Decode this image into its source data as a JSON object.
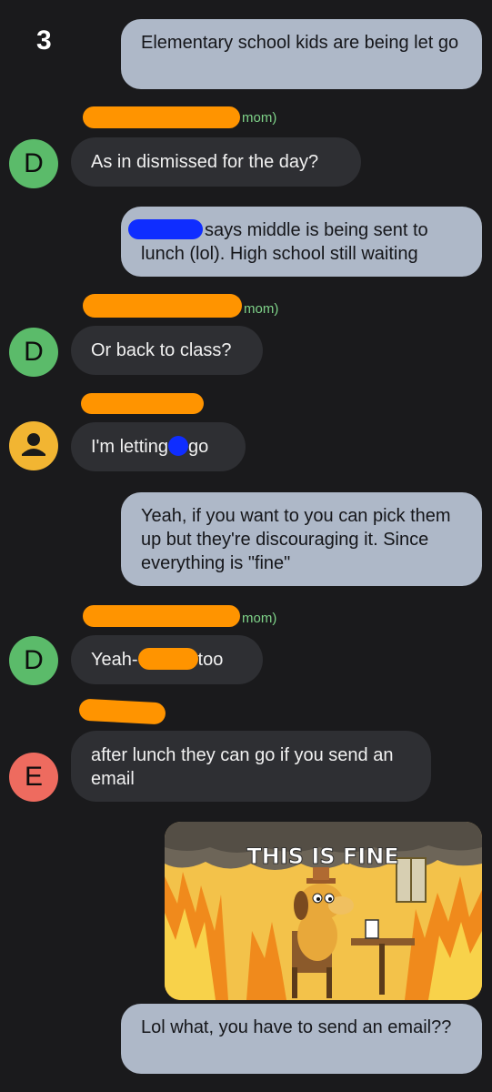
{
  "header": {
    "counter": "3"
  },
  "colors": {
    "background": "#1a1a1c",
    "outgoing_bubble": "#aeb8c8",
    "incoming_bubble": "#2e2f33",
    "avatar_green": "#5bbb6a",
    "avatar_yellow": "#f2b532",
    "avatar_red": "#ee6b5f",
    "redaction_orange": "#ff9400",
    "redaction_blue": "#0f2dff",
    "sender_label": "#7fd389"
  },
  "messages": {
    "m1": {
      "text": "Elementary school kids are being let go"
    },
    "m2": {
      "sender_suffix": "mom)",
      "avatar_letter": "D",
      "text": "As in dismissed for the day?"
    },
    "m3": {
      "text_after_redaction": "says middle is being sent to",
      "text_line2": "lunch (lol). High school still waiting"
    },
    "m4": {
      "sender_suffix": "mom)",
      "avatar_letter": "D",
      "text": "Or back to class?"
    },
    "m5": {
      "avatar_icon": "person-icon",
      "text_before": "I'm letting",
      "text_after": "go"
    },
    "m6": {
      "text": "Yeah, if you want to you can pick them up but they're discouraging it. Since everything is \"fine\""
    },
    "m7": {
      "sender_suffix": "mom)",
      "avatar_letter": "D",
      "text_before": "Yeah-",
      "text_after": "too"
    },
    "m8": {
      "avatar_letter": "E",
      "text": "after lunch they can go if you send an email"
    },
    "m9": {
      "image_caption": "THIS IS FINE",
      "image_subject": "dog-in-burning-room"
    },
    "m10": {
      "text": "Lol what, you have to send an email??"
    }
  }
}
